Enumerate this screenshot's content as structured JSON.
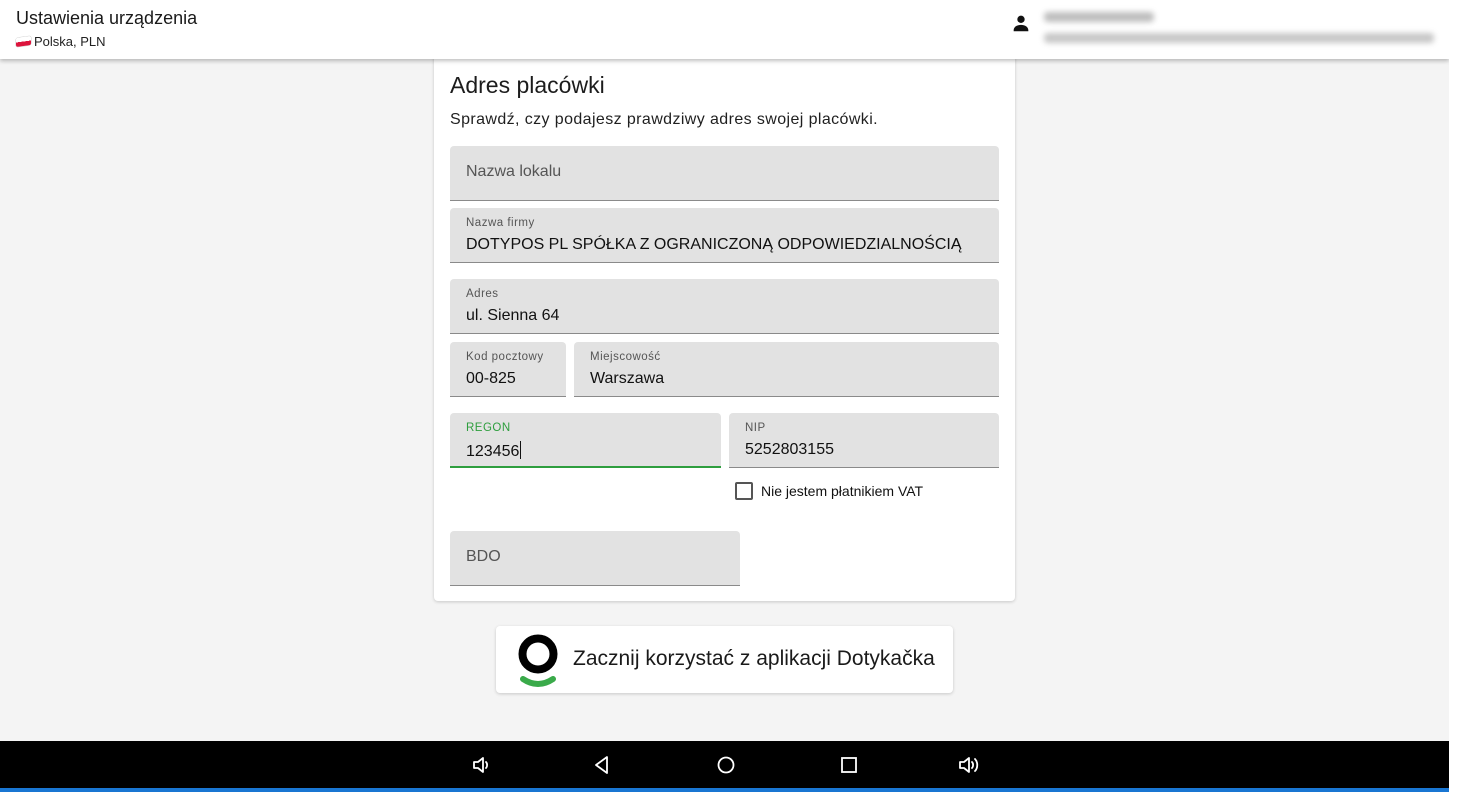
{
  "header": {
    "title": "Ustawienia urządzenia",
    "subtitle": "Polska, PLN"
  },
  "card": {
    "title": "Adres placówki",
    "description": "Sprawdź, czy podajesz prawdziwy adres swojej placówki.",
    "fields": {
      "nazwa_lokalu": {
        "placeholder": "Nazwa lokalu",
        "value": ""
      },
      "nazwa_firmy": {
        "label": "Nazwa firmy",
        "value": "DOTYPOS PL SPÓŁKA Z OGRANICZONĄ ODPOWIEDZIALNOŚCIĄ"
      },
      "adres": {
        "label": "Adres",
        "value": "ul. Sienna 64"
      },
      "kod_pocztowy": {
        "label": "Kod pocztowy",
        "value": "00-825"
      },
      "miejscowosc": {
        "label": "Miejscowość",
        "value": "Warszawa"
      },
      "regon": {
        "label": "REGON",
        "value": "123456"
      },
      "nip": {
        "label": "NIP",
        "value": "5252803155"
      },
      "bdo": {
        "placeholder": "BDO",
        "value": ""
      }
    },
    "vat_checkbox": {
      "label": "Nie jestem płatnikiem VAT",
      "checked": false
    }
  },
  "start_button": {
    "label": "Zacznij korzystać z aplikacji Dotykačka"
  },
  "colors": {
    "focus_green": "#2e9e3e",
    "logo_green": "#3aaa4a",
    "field_bg": "#e2e2e2",
    "page_bg": "#f4f4f4",
    "nav_bg": "#000000"
  },
  "icons": {
    "user": "person-icon",
    "nav": [
      "volume-down-icon",
      "back-icon",
      "home-icon",
      "recents-icon",
      "volume-up-icon"
    ]
  }
}
